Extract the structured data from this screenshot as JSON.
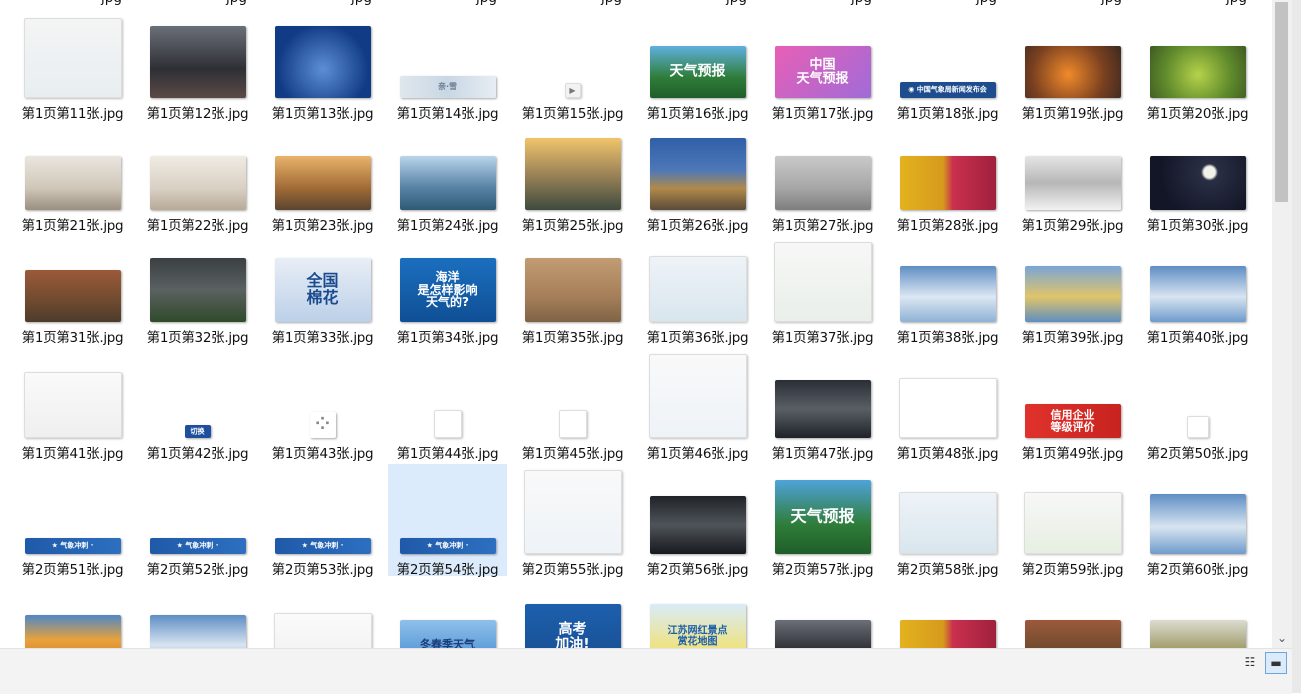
{
  "items": [
    {
      "label": "第1页第11张.jpg",
      "thumb": {
        "w": 96,
        "h": 78,
        "bg": "linear-gradient(#f4f4f4,#e8eef0)",
        "white": true
      }
    },
    {
      "label": "第1页第12张.jpg",
      "thumb": {
        "w": 96,
        "h": 72,
        "bg": "linear-gradient(#6b6f77,#2e2f35 60%,#5b4a45)"
      }
    },
    {
      "label": "第1页第13张.jpg",
      "thumb": {
        "w": 96,
        "h": 72,
        "bg": "radial-gradient(circle at 50% 60%,#5c8fd6,#123b86 70%)"
      }
    },
    {
      "label": "第1页第14张.jpg",
      "thumb": {
        "w": 96,
        "h": 22,
        "bg": "linear-gradient(90deg,#dfe7ee,#c9d7e4,#e7edf3)",
        "text": "亲·雪",
        "color": "#6b7f95",
        "fs": 8
      }
    },
    {
      "label": "第1页第15张.jpg",
      "thumb": {
        "w": 14,
        "h": 13,
        "bg": "#f2f2f2",
        "white": true,
        "text": "▶",
        "color": "#777",
        "fs": 8
      }
    },
    {
      "label": "第1页第16张.jpg",
      "thumb": {
        "w": 96,
        "h": 52,
        "bg": "linear-gradient(#5fb0e0,#2f7d3a 60%,#1f5e2a)",
        "text": "天气预报",
        "color": "#ffffff",
        "fs": 14
      }
    },
    {
      "label": "第1页第17张.jpg",
      "thumb": {
        "w": 96,
        "h": 52,
        "bg": "linear-gradient(135deg,#e85fb6,#a06bd8)",
        "text": "中国\n天气预报",
        "color": "#ffffff",
        "fs": 13
      }
    },
    {
      "label": "第1页第18张.jpg",
      "thumb": {
        "w": 96,
        "h": 16,
        "bg": "#1d4d8f",
        "text": "◉ 中国气象局新闻发布会",
        "color": "#ffffff",
        "fs": 7
      }
    },
    {
      "label": "第1页第19张.jpg",
      "thumb": {
        "w": 96,
        "h": 52,
        "bg": "radial-gradient(circle at 45% 55%,#f08a2a,#7a4020 60%,#3b2a20)"
      }
    },
    {
      "label": "第1页第20张.jpg",
      "thumb": {
        "w": 96,
        "h": 52,
        "bg": "radial-gradient(circle at 50% 55%,#b6d24a,#5f8a2c 60%,#3f5a24)"
      }
    },
    {
      "label": "第1页第21张.jpg",
      "thumb": {
        "w": 96,
        "h": 54,
        "bg": "linear-gradient(#eae6df,#cfc6b8 60%,#9a8f80)"
      }
    },
    {
      "label": "第1页第22张.jpg",
      "thumb": {
        "w": 96,
        "h": 54,
        "bg": "linear-gradient(#f0ebe3,#d9d0c4 60%,#b7aa98)"
      }
    },
    {
      "label": "第1页第23张.jpg",
      "thumb": {
        "w": 96,
        "h": 54,
        "bg": "linear-gradient(#e9b36a,#a06a36 60%,#5a4530)"
      }
    },
    {
      "label": "第1页第24张.jpg",
      "thumb": {
        "w": 96,
        "h": 54,
        "bg": "linear-gradient(#b9d5ec,#5c86a8 55%,#2e5a76)"
      }
    },
    {
      "label": "第1页第25张.jpg",
      "thumb": {
        "w": 96,
        "h": 72,
        "bg": "linear-gradient(#f0c46a,#a58a5a 45%,#3f4a3e)"
      }
    },
    {
      "label": "第1页第26张.jpg",
      "thumb": {
        "w": 96,
        "h": 72,
        "bg": "linear-gradient(#2f5fa8,#4d78b8 45%,#b08a4a 70%,#5a4a38)"
      }
    },
    {
      "label": "第1页第27张.jpg",
      "thumb": {
        "w": 96,
        "h": 54,
        "bg": "linear-gradient(#c9c9c9,#a6a6a6 60%,#7e7e7e)"
      }
    },
    {
      "label": "第1页第28张.jpg",
      "thumb": {
        "w": 96,
        "h": 54,
        "bg": "linear-gradient(90deg,#e3b21f,#d69a1c 45%,#c9304e 55%,#a0203c)"
      }
    },
    {
      "label": "第1页第29张.jpg",
      "thumb": {
        "w": 96,
        "h": 54,
        "bg": "linear-gradient(#e5e5e5,#b7b7b7 50%,#f2f2f2)"
      }
    },
    {
      "label": "第1页第30张.jpg",
      "thumb": {
        "w": 96,
        "h": 54,
        "bg": "radial-gradient(circle at 62% 30%,#f2f2ea 8%,#2a2e44 12%,#131627 70%)"
      }
    },
    {
      "label": "第1页第31张.jpg",
      "thumb": {
        "w": 96,
        "h": 52,
        "bg": "linear-gradient(#9b5a3a,#6f4a2e 60%,#4c3b2c)"
      }
    },
    {
      "label": "第1页第32张.jpg",
      "thumb": {
        "w": 96,
        "h": 64,
        "bg": "linear-gradient(#3a3f41,#5b6161 50%,#2f4a2a)"
      }
    },
    {
      "label": "第1页第33张.jpg",
      "thumb": {
        "w": 96,
        "h": 64,
        "bg": "linear-gradient(#e8eef6,#bcd0e8)",
        "text": "全国\n棉花",
        "color": "#1b4b8f",
        "fs": 16
      }
    },
    {
      "label": "第1页第34张.jpg",
      "thumb": {
        "w": 96,
        "h": 64,
        "bg": "linear-gradient(#1b6fbf,#0f4f95)",
        "text": "海洋\n是怎样影响\n天气的?",
        "color": "#ffffff",
        "fs": 12
      }
    },
    {
      "label": "第1页第35张.jpg",
      "thumb": {
        "w": 96,
        "h": 64,
        "bg": "linear-gradient(#c29c73,#a67f5a 60%,#7f6345)"
      }
    },
    {
      "label": "第1页第36张.jpg",
      "thumb": {
        "w": 96,
        "h": 64,
        "bg": "linear-gradient(#eef3f7,#d9e6ee)",
        "white": true
      }
    },
    {
      "label": "第1页第37张.jpg",
      "thumb": {
        "w": 96,
        "h": 78,
        "bg": "linear-gradient(#f7f7f7,#e9efe9)",
        "white": true
      }
    },
    {
      "label": "第1页第38张.jpg",
      "thumb": {
        "w": 96,
        "h": 56,
        "bg": "linear-gradient(#5e8ec4,#dce7f2 55%,#8fb2d6)"
      }
    },
    {
      "label": "第1页第39张.jpg",
      "thumb": {
        "w": 96,
        "h": 56,
        "bg": "linear-gradient(#7aa5d6,#e0c46a 55%,#5f8ec0)"
      }
    },
    {
      "label": "第1页第40张.jpg",
      "thumb": {
        "w": 96,
        "h": 56,
        "bg": "linear-gradient(#5e8ec4,#d8e4f0 55%,#6f9bcc)"
      }
    },
    {
      "label": "第1页第41张.jpg",
      "thumb": {
        "w": 96,
        "h": 64,
        "bg": "linear-gradient(#fafafa,#efefef)",
        "white": true
      }
    },
    {
      "label": "第1页第42张.jpg",
      "thumb": {
        "w": 26,
        "h": 13,
        "bg": "#1f4f9c",
        "text": "切换",
        "color": "#ffffff",
        "fs": 7
      }
    },
    {
      "label": "第1页第43张.jpg",
      "thumb": {
        "w": 26,
        "h": 26,
        "bg": "#ffffff",
        "text": "⁘",
        "color": "#888888",
        "fs": 18
      }
    },
    {
      "label": "第1页第44张.jpg",
      "thumb": {
        "w": 26,
        "h": 26,
        "bg": "#ffffff",
        "white": true
      }
    },
    {
      "label": "第1页第45张.jpg",
      "thumb": {
        "w": 26,
        "h": 26,
        "bg": "#ffffff",
        "white": true
      }
    },
    {
      "label": "第1页第46张.jpg",
      "thumb": {
        "w": 96,
        "h": 82,
        "bg": "linear-gradient(#f9f9f9,#eef3f8)",
        "white": true
      }
    },
    {
      "label": "第1页第47张.jpg",
      "thumb": {
        "w": 96,
        "h": 58,
        "bg": "linear-gradient(#2a2e35,#5a5f66 50%,#1f2328)"
      }
    },
    {
      "label": "第1页第48张.jpg",
      "thumb": {
        "w": 96,
        "h": 58,
        "bg": "#ffffff",
        "white": true
      }
    },
    {
      "label": "第1页第49张.jpg",
      "thumb": {
        "w": 96,
        "h": 34,
        "bg": "linear-gradient(90deg,#e0322c,#c8231f)",
        "text": "信用企业\n等级评价",
        "color": "#ffffff",
        "fs": 11
      }
    },
    {
      "label": "第2页第50张.jpg",
      "thumb": {
        "w": 20,
        "h": 20,
        "bg": "#ffffff",
        "white": true
      }
    },
    {
      "label": "第2页第51张.jpg",
      "thumb": {
        "w": 96,
        "h": 16,
        "bg": "linear-gradient(90deg,#1f5aa8,#2d6fc0)",
        "text": "★ 气象冲刺 ·",
        "color": "#ffffff",
        "fs": 7
      }
    },
    {
      "label": "第2页第52张.jpg",
      "thumb": {
        "w": 96,
        "h": 16,
        "bg": "linear-gradient(90deg,#1f5aa8,#2d6fc0)",
        "text": "★ 气象冲刺 ·",
        "color": "#ffffff",
        "fs": 7
      }
    },
    {
      "label": "第2页第53张.jpg",
      "thumb": {
        "w": 96,
        "h": 16,
        "bg": "linear-gradient(90deg,#1f5aa8,#2d6fc0)",
        "text": "★ 气象冲刺 ·",
        "color": "#ffffff",
        "fs": 7
      }
    },
    {
      "label": "第2页第54张.jpg",
      "thumb": {
        "w": 96,
        "h": 16,
        "bg": "linear-gradient(90deg,#1f5aa8,#2d6fc0)",
        "text": "★ 气象冲刺 ·",
        "color": "#ffffff",
        "fs": 7
      },
      "selected": true
    },
    {
      "label": "第2页第55张.jpg",
      "thumb": {
        "w": 96,
        "h": 82,
        "bg": "linear-gradient(#f9f9f9,#eef3f8)",
        "white": true
      }
    },
    {
      "label": "第2页第56张.jpg",
      "thumb": {
        "w": 96,
        "h": 58,
        "bg": "linear-gradient(#1f2328,#4f545a 50%,#16191d)"
      }
    },
    {
      "label": "第2页第57张.jpg",
      "thumb": {
        "w": 96,
        "h": 74,
        "bg": "linear-gradient(#4fa3da,#2f7d3a 60%,#1f5e2a)",
        "text": "天气预报",
        "color": "#ffffff",
        "fs": 16
      }
    },
    {
      "label": "第2页第58张.jpg",
      "thumb": {
        "w": 96,
        "h": 60,
        "bg": "linear-gradient(#eef3f7,#d9e6ee)",
        "white": true
      }
    },
    {
      "label": "第2页第59张.jpg",
      "thumb": {
        "w": 96,
        "h": 60,
        "bg": "linear-gradient(#f7f7f7,#e6efe2)",
        "white": true
      }
    },
    {
      "label": "第2页第60张.jpg",
      "thumb": {
        "w": 96,
        "h": 60,
        "bg": "linear-gradient(#5e8ec4,#d8e4f0 55%,#6f9bcc)"
      }
    },
    {
      "label": "",
      "thumb": {
        "w": 96,
        "h": 55,
        "bg": "linear-gradient(#4f87c8,#e8a23a 45%,#d0702a)"
      }
    },
    {
      "label": "",
      "thumb": {
        "w": 96,
        "h": 55,
        "bg": "linear-gradient(#5e8ec4,#d8e4f0 55%,#6f9bcc)"
      }
    },
    {
      "label": "",
      "thumb": {
        "w": 96,
        "h": 55,
        "bg": "linear-gradient(#fbfbfb,#efefef)",
        "white": true
      }
    },
    {
      "label": "",
      "thumb": {
        "w": 96,
        "h": 50,
        "bg": "linear-gradient(#8fc0ea,#3f86cf)",
        "text": "冬春季天气",
        "color": "#1b3d7a",
        "fs": 11
      }
    },
    {
      "label": "",
      "thumb": {
        "w": 96,
        "h": 66,
        "bg": "linear-gradient(#1d5fad,#174d8f)",
        "text": "高考\n加油!",
        "color": "#ffffff",
        "fs": 14
      }
    },
    {
      "label": "",
      "thumb": {
        "w": 96,
        "h": 66,
        "bg": "linear-gradient(#d8ecf8,#f0e27a 70%,#8cc46a)",
        "text": "江苏网红景点\n赏花地图",
        "color": "#1d5fad",
        "fs": 10
      }
    },
    {
      "label": "",
      "thumb": {
        "w": 96,
        "h": 50,
        "bg": "linear-gradient(#6b6f77,#2e2f35 60%,#5b4a45)"
      }
    },
    {
      "label": "",
      "thumb": {
        "w": 96,
        "h": 50,
        "bg": "linear-gradient(90deg,#e3b21f,#d69a1c 45%,#c9304e 55%,#a0203c)"
      }
    },
    {
      "label": "",
      "thumb": {
        "w": 96,
        "h": 50,
        "bg": "linear-gradient(#9b5a3a,#6f4a2e 60%,#4c3b2c)"
      }
    },
    {
      "label": "",
      "thumb": {
        "w": 96,
        "h": 50,
        "bg": "linear-gradient(#dcdcd0,#a4a070 55%,#6f6a3a)"
      }
    }
  ],
  "top_cut_labels": [
    "jpg",
    "jpg",
    "jpg",
    "jpg",
    "jpg",
    "jpg",
    "jpg",
    "jpg",
    "jpg",
    "jpg"
  ],
  "view_icons": {
    "details": "details-view-icon",
    "thumbnails": "large-icons-view-icon"
  },
  "colors": {
    "selection": "#dcebfb",
    "status_bar": "#f3f3f3"
  }
}
